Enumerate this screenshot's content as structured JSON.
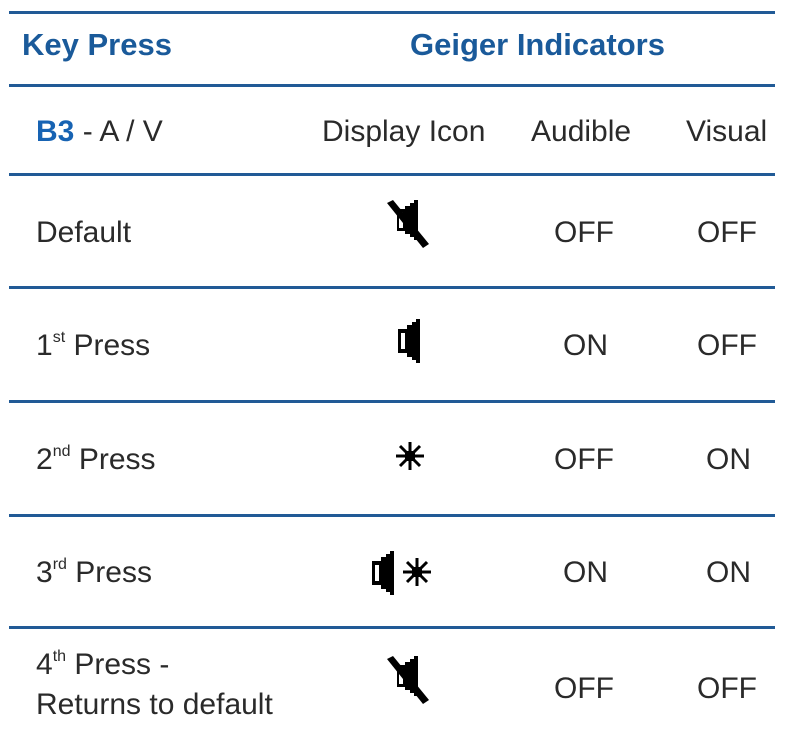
{
  "header": {
    "key_press": "Key Press",
    "geiger_indicators": "Geiger Indicators"
  },
  "subheader": {
    "button": "B3",
    "mode": "- A / V",
    "display_icon": "Display Icon",
    "audible": "Audible",
    "visual": "Visual"
  },
  "rows": [
    {
      "n": "",
      "sup": "",
      "label": "Default",
      "label2": "",
      "icon": "speaker-muted-icon",
      "audible": "OFF",
      "visual": "OFF"
    },
    {
      "n": "1",
      "sup": "st",
      "label": "Press",
      "label2": "",
      "icon": "speaker-icon",
      "audible": "ON",
      "visual": "OFF"
    },
    {
      "n": "2",
      "sup": "nd",
      "label": "Press",
      "label2": "",
      "icon": "light-icon",
      "audible": "OFF",
      "visual": "ON"
    },
    {
      "n": "3",
      "sup": "rd",
      "label": "Press",
      "label2": "",
      "icon": "speaker-and-light-icon",
      "audible": "ON",
      "visual": "ON"
    },
    {
      "n": "4",
      "sup": "th",
      "label": "Press -",
      "label2": "Returns to default",
      "icon": "speaker-muted-icon",
      "audible": "OFF",
      "visual": "OFF"
    }
  ],
  "colors": {
    "accent": "#1a5a9a",
    "rule": "#215a96",
    "text": "#2a2a2a"
  }
}
